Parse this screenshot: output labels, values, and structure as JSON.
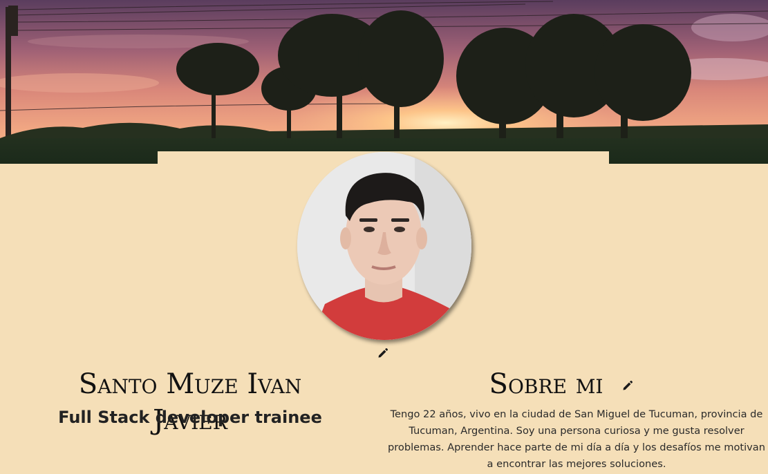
{
  "banner": {
    "icon": "sunset-landscape-image"
  },
  "profile": {
    "photo_icon": "profile-photo",
    "edit_photo_icon": "pencil-icon",
    "name": "Santo Muze Ivan Javier",
    "role": "Full Stack developer trainee"
  },
  "about": {
    "title": "Sobre mi",
    "edit_icon": "pencil-icon",
    "text": "Tengo 22 años, vivo en la ciudad de San Miguel de Tucuman, provincia de Tucuman, Argentina. Soy una persona curiosa y me gusta resolver problemas. Aprender hace parte de mi día a día y los desafíos me motivan a encontrar las mejores soluciones."
  },
  "colors": {
    "background": "#f5dfb8",
    "text": "#1f1f1f"
  }
}
